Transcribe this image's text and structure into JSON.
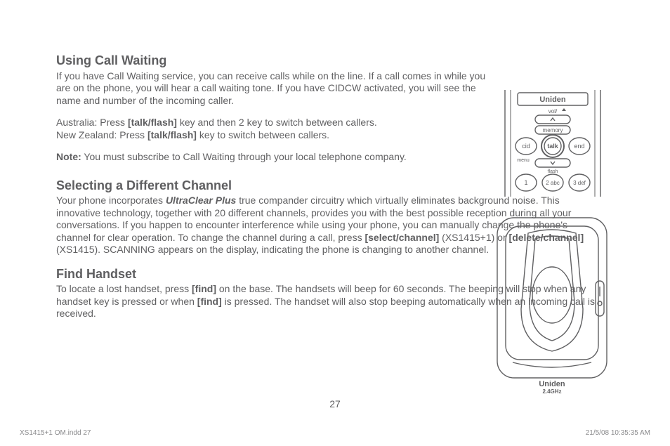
{
  "section1": {
    "heading": "Using Call Waiting",
    "p1": "If you have Call Waiting service, you can receive calls while on the line. If a call comes in while you are on the phone, you will hear a call waiting tone. If you have CIDCW activated, you will see the name and number of the incoming caller.",
    "aus_pre": "Australia:  Press ",
    "aus_key": "[talk/flash]",
    "aus_post": " key and then 2 key to switch between callers.",
    "nz_pre": "New Zealand:  Press ",
    "nz_key": "[talk/flash]",
    "nz_post": " key to switch between callers.",
    "note_label": "Note:",
    "note_text": " You must subscribe to Call Waiting through your local telephone company."
  },
  "section2": {
    "heading": "Selecting a Different Channel",
    "p_pre": "Your phone incorporates ",
    "uc": "UltraClear Plus",
    "p_mid": " true compander circuitry which virtually eliminates background noise. This innovative technology, together with 20 different channels, provides you with the best possible reception during all your conversations. If you happen to encounter interference while using your phone, you can manually change the phone's channel for clear operation. To change the channel during a call, press ",
    "sel": "[select/channel]",
    "p_mid2": " (XS1415+1) or ",
    "del": "[delete/channel]",
    "p_post": " (XS1415). SCANNING appears on the display, indicating the phone is changing to another channel."
  },
  "section3": {
    "heading": "Find Handset",
    "p_pre": "To locate a lost handset, press ",
    "find1": "[find]",
    "p_mid": " on the base. The handsets will beep for 60 seconds. The beeping will stop when any handset key is pressed or when ",
    "find2": "[find]",
    "p_post": " is pressed. The handset will also stop beeping automatically when an incoming call is received."
  },
  "illus": {
    "brand": "Uniden",
    "vol": "vol/",
    "memory": "memory",
    "cid": "cid",
    "talk": "talk",
    "end": "end",
    "menu": "menu",
    "flash": "flash",
    "k1": "1",
    "k2": "2 abc",
    "k3": "3 def",
    "ghz": "2.4GHz"
  },
  "page_number": "27",
  "footer_left": "XS1415+1 OM.indd   27",
  "footer_right": "21/5/08   10:35:35 AM"
}
